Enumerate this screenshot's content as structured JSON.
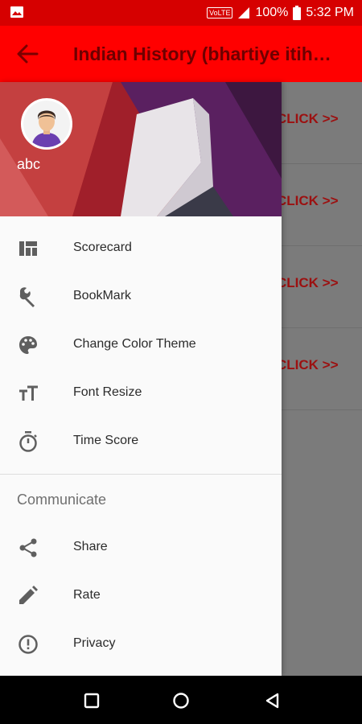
{
  "status_bar": {
    "volte": "VoLTE",
    "battery": "100%",
    "time": "5:32 PM",
    "color": "#d60000"
  },
  "toolbar": {
    "title": "Indian History (bhartiye itihas)",
    "back_icon": "arrow-left-icon",
    "color": "#ff0000"
  },
  "content": {
    "rows": [
      {
        "link": "CLICK >>"
      },
      {
        "link": "CLICK >>"
      },
      {
        "link": "CLICK >>"
      },
      {
        "link": "CLICK >>"
      }
    ]
  },
  "drawer": {
    "user_name": "abc",
    "items": [
      {
        "label": "Scorecard",
        "icon": "dashboard-icon"
      },
      {
        "label": "BookMark",
        "icon": "wrench-icon"
      },
      {
        "label": "Change Color Theme",
        "icon": "palette-icon"
      },
      {
        "label": "Font Resize",
        "icon": "text-size-icon"
      },
      {
        "label": "Time Score",
        "icon": "timer-icon"
      }
    ],
    "section_title": "Communicate",
    "section_items": [
      {
        "label": "Share",
        "icon": "share-icon"
      },
      {
        "label": "Rate",
        "icon": "pencil-icon"
      },
      {
        "label": "Privacy",
        "icon": "alert-circle-icon"
      }
    ]
  },
  "nav_bar": {
    "icons": [
      "square-icon",
      "circle-icon",
      "triangle-back-icon"
    ]
  }
}
